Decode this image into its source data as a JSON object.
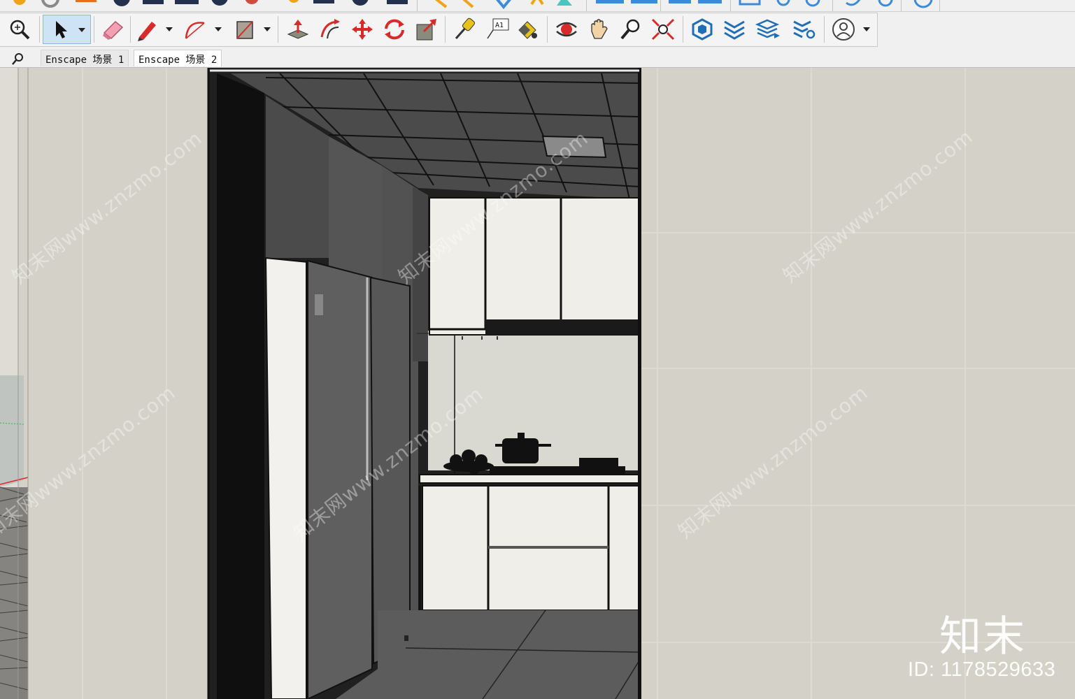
{
  "toolbar": {
    "tools": [
      {
        "name": "zoom-extents-tool",
        "icon": "magnifier-icon"
      },
      {
        "name": "select-tool",
        "icon": "arrow-cursor-icon",
        "active": true
      },
      {
        "name": "eraser-tool",
        "icon": "eraser-icon"
      },
      {
        "name": "line-tool",
        "icon": "pencil-icon"
      },
      {
        "name": "arc-tool",
        "icon": "arc-icon"
      },
      {
        "name": "rectangle-tool",
        "icon": "rectangle-icon"
      },
      {
        "name": "push-pull-tool",
        "icon": "push-pull-icon"
      },
      {
        "name": "offset-tool",
        "icon": "offset-icon"
      },
      {
        "name": "move-tool",
        "icon": "move-arrows-icon"
      },
      {
        "name": "rotate-tool",
        "icon": "rotate-icon"
      },
      {
        "name": "scale-tool",
        "icon": "scale-icon"
      },
      {
        "name": "tape-measure-tool",
        "icon": "tape-measure-icon"
      },
      {
        "name": "text-tool",
        "icon": "text-label-icon",
        "label": "A1"
      },
      {
        "name": "paint-bucket-tool",
        "icon": "paint-bucket-icon"
      },
      {
        "name": "orbit-tool",
        "icon": "orbit-icon"
      },
      {
        "name": "pan-tool",
        "icon": "hand-icon"
      },
      {
        "name": "zoom-tool",
        "icon": "zoom-icon"
      },
      {
        "name": "zoom-window-tool",
        "icon": "zoom-extents-icon"
      },
      {
        "name": "3d-warehouse-button",
        "icon": "warehouse-icon"
      },
      {
        "name": "extension-warehouse-button",
        "icon": "extension-icon"
      },
      {
        "name": "layers-button",
        "icon": "layers-icon"
      },
      {
        "name": "extension-manager-button",
        "icon": "extension-manager-icon"
      },
      {
        "name": "account-button",
        "icon": "user-account-icon"
      }
    ]
  },
  "scene_tabs": {
    "search_icon": "search-icon",
    "tabs": [
      "Enscape 场景 1",
      "Enscape 场景 2"
    ]
  },
  "viewport": {
    "watermark_text": "知末网www.znzmo.com",
    "brand_logo": "知末",
    "brand_id": "ID: 1178529633"
  },
  "colors": {
    "wall": "#d4d2c9",
    "ceiling": "#4a4a4a",
    "cabinet": "#efeee9",
    "floor": "#5a5a5a",
    "select_highlight": "#cfe3f7"
  }
}
